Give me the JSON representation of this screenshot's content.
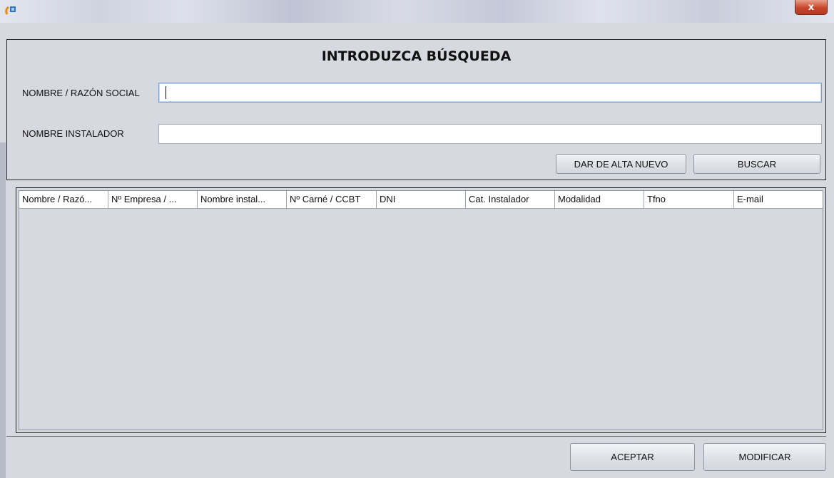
{
  "window": {
    "app_icon": "java-app-icon",
    "close_label": "x"
  },
  "search": {
    "title": "INTRODUZCA BÚSQUEDA",
    "name_label": "NOMBRE / RAZÓN SOCIAL",
    "name_value": "",
    "installer_label": "NOMBRE INSTALADOR",
    "installer_value": "",
    "new_button": "DAR DE ALTA NUEVO",
    "search_button": "BUSCAR"
  },
  "table": {
    "columns": [
      "Nombre / Razó...",
      "Nº Empresa / ...",
      "Nombre instal...",
      "Nº Carné / CCBT",
      "DNI",
      "Cat. Instalador",
      "Modalidad",
      "Tfno",
      "E-mail"
    ],
    "rows": []
  },
  "footer": {
    "accept_button": "ACEPTAR",
    "modify_button": "MODIFICAR"
  },
  "colors": {
    "background": "#d6d9df",
    "close_button": "#c7452a"
  }
}
